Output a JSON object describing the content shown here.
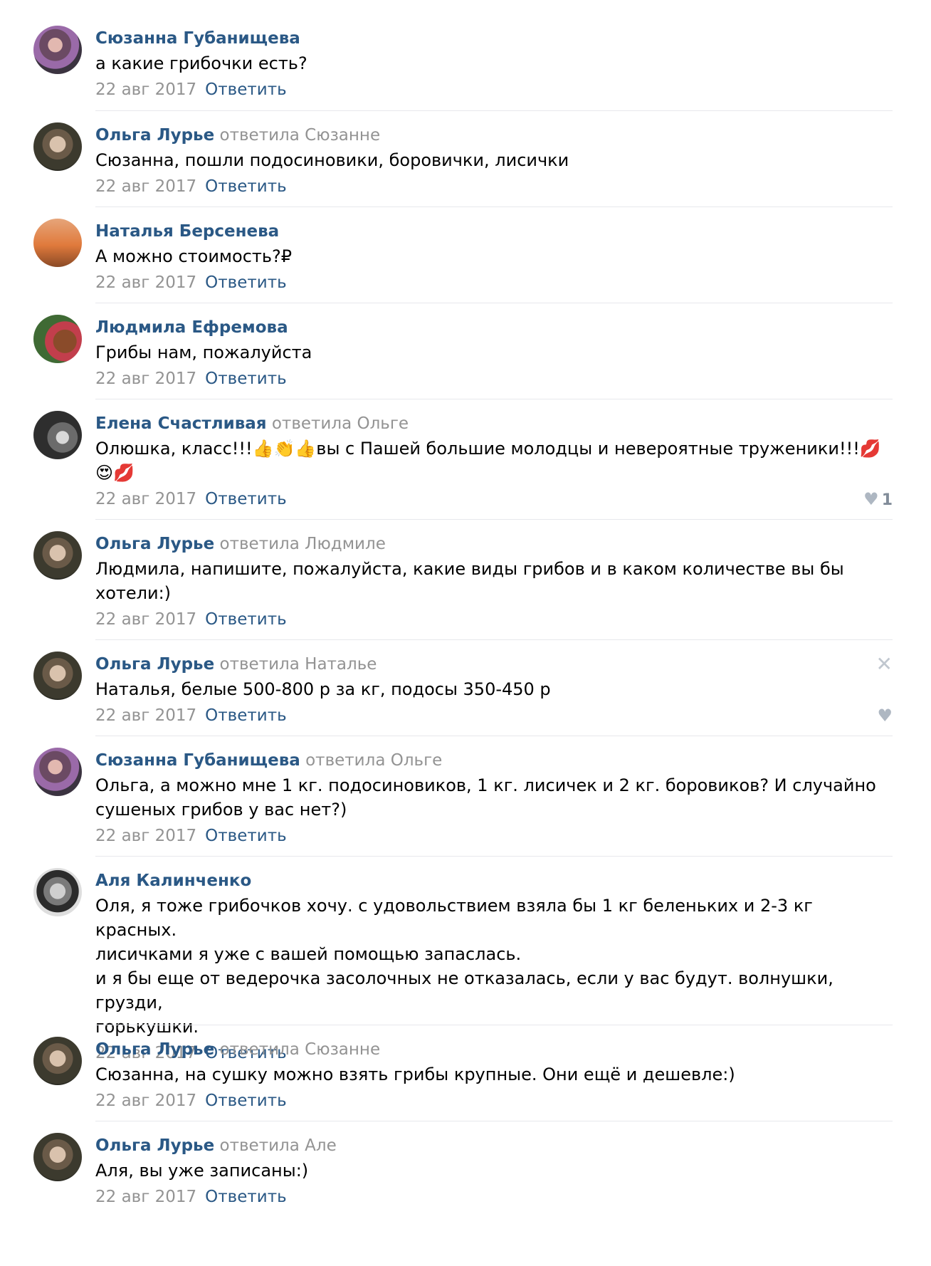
{
  "reply_label": "Ответить",
  "comments": [
    {
      "author": "Сюзанна Губанищева",
      "reply_to": "",
      "text": "а какие грибочки есть?",
      "date": "22 авг 2017"
    },
    {
      "author": "Ольга Лурье",
      "reply_to": "ответила Сюзанне",
      "text": "Сюзанна, пошли подосиновики, боровички, лисички",
      "date": "22 авг 2017"
    },
    {
      "author": "Наталья Берсенева",
      "reply_to": "",
      "text": "А можно стоимость?₽",
      "date": "22 авг 2017"
    },
    {
      "author": "Людмила Ефремова",
      "reply_to": "",
      "text": "Грибы нам, пожалуйста",
      "date": "22 авг 2017"
    },
    {
      "author": "Елена Счастливая",
      "reply_to": "ответила Ольге",
      "text": "Олюшка, класс!!!👍👏👍вы с Пашей большие молодцы и невероятные труженики!!!💋\n😍💋",
      "date": "22 авг 2017",
      "like_count": "1"
    },
    {
      "author": "Ольга Лурье",
      "reply_to": "ответила Людмиле",
      "text": "Людмила, напишите, пожалуйста, какие виды грибов и в каком количестве вы бы\nхотели:)",
      "date": "22 авг 2017"
    },
    {
      "author": "Ольга Лурье",
      "reply_to": "ответила Наталье",
      "text": "Наталья, белые 500-800 р за кг, подосы 350-450 р",
      "date": "22 авг 2017",
      "close_icon": "✕"
    },
    {
      "author": "Сюзанна Губанищева",
      "reply_to": "ответила Ольге",
      "text": "Ольга, а можно мне 1 кг. подосиновиков, 1 кг. лисичек и 2 кг. боровиков? И случайно\nсушеных грибов у вас нет?)",
      "date": "22 авг 2017"
    },
    {
      "author": "Аля Калинченко",
      "reply_to": "",
      "text": "Оля, я тоже грибочков хочу. с удовольствием взяла бы 1 кг беленьких и 2-3 кг красных.\nлисичками я уже с вашей помощью запаслась.\nи я бы еще от ведерочка засолочных не отказалась, если у вас будут. волнушки, грузди,\nгорькушки.",
      "date": "22 авг 2017"
    },
    {
      "author": "Ольга Лурье",
      "reply_to": "ответила Сюзанне",
      "text": "Сюзанна, на сушку можно взять грибы крупные. Они ещё и дешевле:)",
      "date": "22 авг 2017"
    },
    {
      "author": "Ольга Лурье",
      "reply_to": "ответила Але",
      "text": "Аля, вы уже записаны:)",
      "date": "22 авг 2017"
    }
  ]
}
